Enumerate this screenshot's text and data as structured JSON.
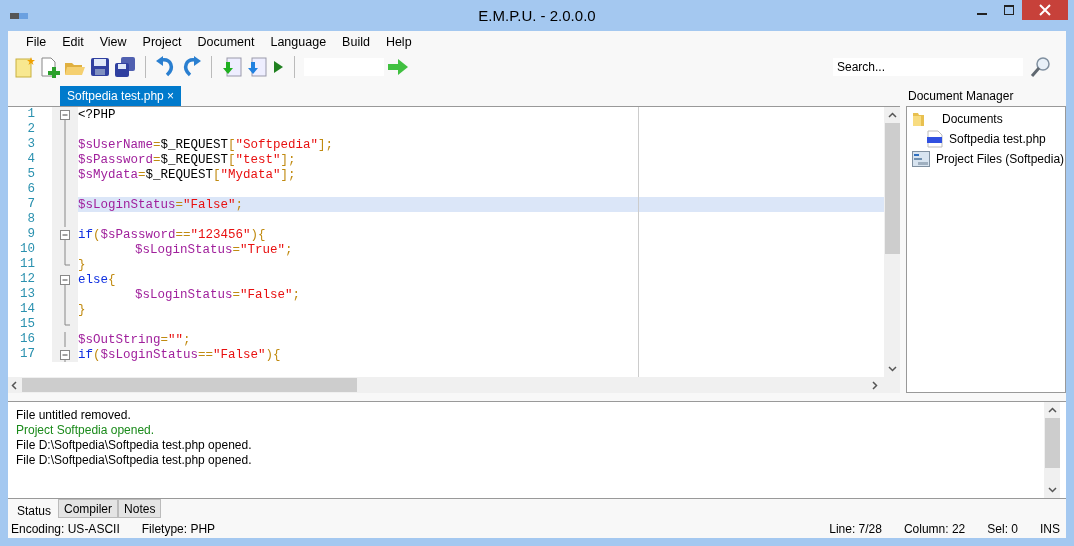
{
  "window": {
    "title": "E.M.P.U. - 2.0.0.0"
  },
  "menu": [
    "File",
    "Edit",
    "View",
    "Project",
    "Document",
    "Language",
    "Build",
    "Help"
  ],
  "search": {
    "placeholder": "Search..."
  },
  "editor_tabs": [
    {
      "label": "Softpedia test.php",
      "close": "×",
      "selected": true
    }
  ],
  "editor": {
    "lines": [
      {
        "number": "1",
        "kind": "fold-start",
        "current": false,
        "tokens": [
          {
            "kind": "plain",
            "text": "<?PHP"
          }
        ]
      },
      {
        "number": "2",
        "kind": "fold-line",
        "current": false
      },
      {
        "number": "3",
        "kind": "fold-line",
        "current": false,
        "tokens": [
          {
            "kind": "var",
            "text": "$sUserName"
          },
          {
            "kind": "op",
            "text": "="
          },
          {
            "kind": "plain",
            "text": "$_REQUEST"
          },
          {
            "kind": "op",
            "text": "["
          },
          {
            "kind": "str",
            "text": "\"Softpedia\""
          },
          {
            "kind": "op",
            "text": "];"
          }
        ]
      },
      {
        "number": "4",
        "kind": "fold-line",
        "current": false,
        "tokens": [
          {
            "kind": "var",
            "text": "$sPassword"
          },
          {
            "kind": "op",
            "text": "="
          },
          {
            "kind": "plain",
            "text": "$_REQUEST"
          },
          {
            "kind": "op",
            "text": "["
          },
          {
            "kind": "str",
            "text": "\"test\""
          },
          {
            "kind": "op",
            "text": "];"
          }
        ]
      },
      {
        "number": "5",
        "kind": "fold-line",
        "current": false,
        "tokens": [
          {
            "kind": "var",
            "text": "$sMydata"
          },
          {
            "kind": "op",
            "text": "="
          },
          {
            "kind": "plain",
            "text": "$_REQUEST"
          },
          {
            "kind": "op",
            "text": "["
          },
          {
            "kind": "str",
            "text": "\"Mydata\""
          },
          {
            "kind": "op",
            "text": "];"
          }
        ]
      },
      {
        "number": "6",
        "kind": "fold-line",
        "current": false
      },
      {
        "number": "7",
        "kind": "fold-line",
        "current": true,
        "tokens": [
          {
            "kind": "var",
            "text": "$sLoginStatus"
          },
          {
            "kind": "op",
            "text": "="
          },
          {
            "kind": "str",
            "text": "\"False\""
          },
          {
            "kind": "op",
            "text": ";"
          }
        ]
      },
      {
        "number": "8",
        "kind": "fold-line",
        "current": false
      },
      {
        "number": "9",
        "kind": "fold-start",
        "current": false,
        "tokens": [
          {
            "kind": "kw",
            "text": "if"
          },
          {
            "kind": "op",
            "text": "("
          },
          {
            "kind": "var",
            "text": "$sPassword"
          },
          {
            "kind": "op",
            "text": "=="
          },
          {
            "kind": "str",
            "text": "\"123456\""
          },
          {
            "kind": "op",
            "text": "){"
          }
        ]
      },
      {
        "number": "10",
        "kind": "fold-line",
        "current": false,
        "indent": true,
        "tokens": [
          {
            "kind": "var",
            "text": "$sLoginStatus"
          },
          {
            "kind": "op",
            "text": "="
          },
          {
            "kind": "str",
            "text": "\"True\""
          },
          {
            "kind": "op",
            "text": ";"
          }
        ]
      },
      {
        "number": "11",
        "kind": "fold-end",
        "current": false,
        "tokens": [
          {
            "kind": "op",
            "text": "}"
          }
        ]
      },
      {
        "number": "12",
        "kind": "fold-start",
        "current": false,
        "tokens": [
          {
            "kind": "kw",
            "text": "else"
          },
          {
            "kind": "op",
            "text": "{"
          }
        ]
      },
      {
        "number": "13",
        "kind": "fold-line",
        "current": false,
        "indent": true,
        "tokens": [
          {
            "kind": "var",
            "text": "$sLoginStatus"
          },
          {
            "kind": "op",
            "text": "="
          },
          {
            "kind": "str",
            "text": "\"False\""
          },
          {
            "kind": "op",
            "text": ";"
          }
        ]
      },
      {
        "number": "14",
        "kind": "fold-line",
        "current": false,
        "tokens": [
          {
            "kind": "op",
            "text": "}"
          }
        ]
      },
      {
        "number": "15",
        "kind": "fold-end",
        "current": false
      },
      {
        "number": "16",
        "kind": "fold-line",
        "current": false,
        "tokens": [
          {
            "kind": "var",
            "text": "$sOutString"
          },
          {
            "kind": "op",
            "text": "="
          },
          {
            "kind": "str",
            "text": "\"\""
          },
          {
            "kind": "op",
            "text": ";"
          }
        ]
      },
      {
        "number": "17",
        "kind": "fold-start",
        "current": false,
        "tokens": [
          {
            "kind": "kw",
            "text": "if"
          },
          {
            "kind": "op",
            "text": "("
          },
          {
            "kind": "var",
            "text": "$sLoginStatus"
          },
          {
            "kind": "op",
            "text": "=="
          },
          {
            "kind": "str",
            "text": "\"False\""
          },
          {
            "kind": "op",
            "text": "){"
          }
        ]
      }
    ]
  },
  "document_manager": {
    "title": "Document Manager",
    "tree": [
      {
        "label": "Documents",
        "kind": "folder",
        "children": [
          {
            "label": "Softpedia test.php",
            "kind": "php"
          }
        ]
      },
      {
        "label": "Project Files (Softpedia)",
        "kind": "project"
      }
    ]
  },
  "output": {
    "lines": [
      {
        "text": "File untitled removed.",
        "kind": "info"
      },
      {
        "text": "Project Softpedia opened.",
        "kind": "success"
      },
      {
        "text": "File D:\\Softpedia\\Softpedia test.php opened.",
        "kind": "info"
      },
      {
        "text": "File D:\\Softpedia\\Softpedia test.php opened.",
        "kind": "info"
      }
    ]
  },
  "output_tabs": [
    {
      "label": "Status",
      "selected": true
    },
    {
      "label": "Compiler",
      "selected": false
    },
    {
      "label": "Notes",
      "selected": false
    }
  ],
  "status_bar": {
    "encoding": "Encoding: US-ASCII",
    "filetype": "Filetype: PHP",
    "line": "Line: 7/28",
    "column": "Column: 22",
    "selection": "Sel: 0",
    "mode": "INS"
  }
}
